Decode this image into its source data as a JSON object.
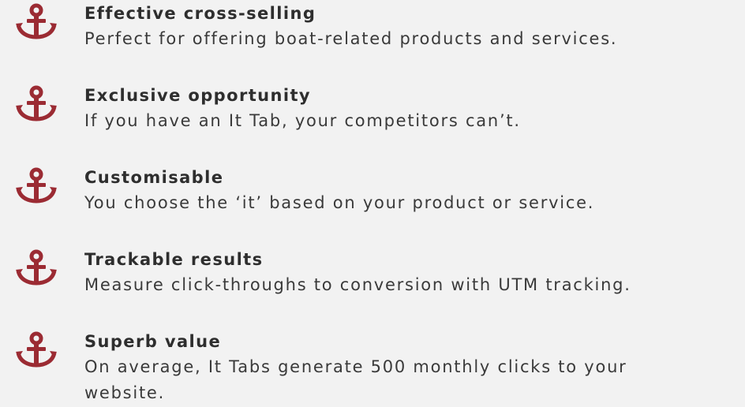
{
  "accent_color": "#9b2b33",
  "icon_name": "anchor-icon",
  "features": [
    {
      "title": "Effective cross-selling",
      "description": "Perfect for offering boat-related products and services."
    },
    {
      "title": "Exclusive opportunity",
      "description": "If you have an It Tab, your competitors can’t."
    },
    {
      "title": "Customisable",
      "description": "You choose the ‘it’ based on your product or service."
    },
    {
      "title": "Trackable results",
      "description": "Measure click-throughs to conversion with UTM tracking."
    },
    {
      "title": "Superb value",
      "description": "On average, It Tabs generate 500 monthly clicks to your website."
    }
  ]
}
